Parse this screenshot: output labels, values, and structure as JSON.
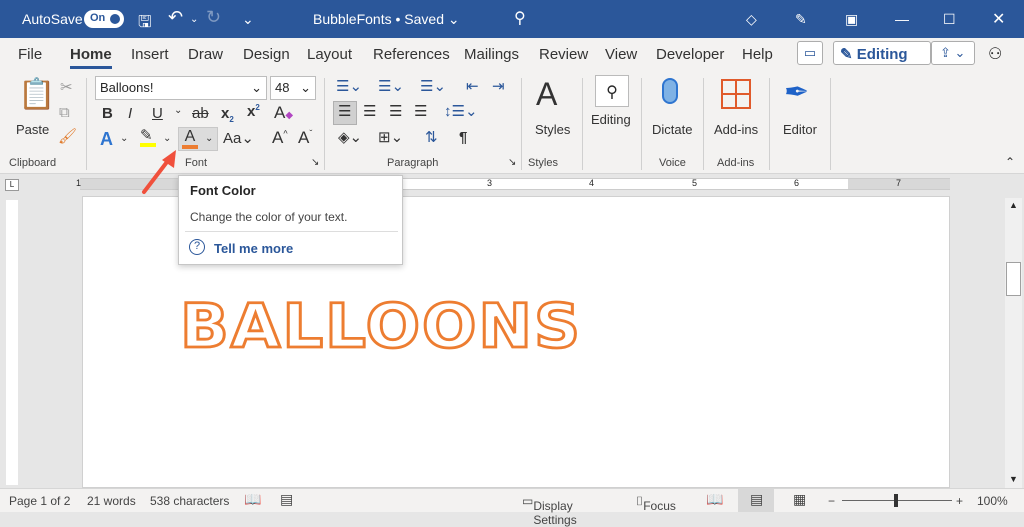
{
  "titlebar": {
    "autosave": "AutoSave",
    "toggle": "On",
    "doc_title": "BubbleFonts • Saved ⌄"
  },
  "tabs": [
    "File",
    "Home",
    "Insert",
    "Draw",
    "Design",
    "Layout",
    "References",
    "Mailings",
    "Review",
    "View",
    "Developer",
    "Help"
  ],
  "editing_button": "Editing",
  "font": {
    "name": "Balloons!",
    "size": "48"
  },
  "groups": {
    "clipboard": "Clipboard",
    "font": "Font",
    "paragraph": "Paragraph",
    "styles": "Styles",
    "voice": "Voice",
    "addins": "Add-ins"
  },
  "big_buttons": {
    "paste": "Paste",
    "styles": "Styles",
    "editing": "Editing",
    "dictate": "Dictate",
    "addins": "Add-ins",
    "editor": "Editor"
  },
  "tooltip": {
    "title": "Font Color",
    "desc": "Change the color of your text.",
    "link": "Tell me more"
  },
  "document": {
    "text": "BALLOONS"
  },
  "ruler": [
    "1",
    "1",
    "2",
    "3",
    "4",
    "5",
    "6",
    "7"
  ],
  "status": {
    "page": "Page 1 of 2",
    "words": "21 words",
    "chars": "538 characters",
    "display": "Display Settings",
    "focus": "Focus",
    "zoom": "100%"
  },
  "colors": {
    "title": "#2b579a",
    "font_color": "#ed7d31",
    "highlight": "#ffff00"
  }
}
